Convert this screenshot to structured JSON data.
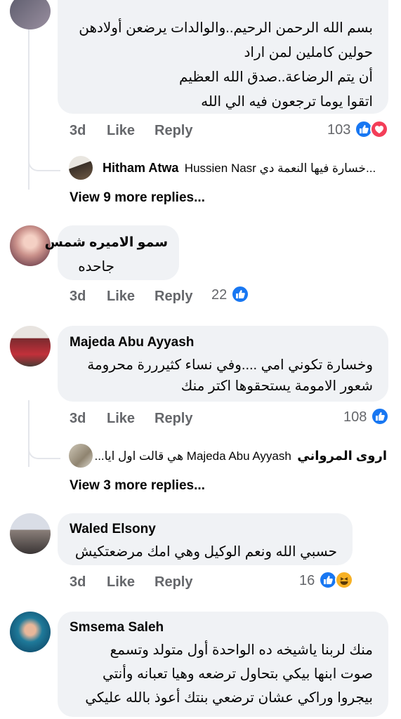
{
  "comments": [
    {
      "lines": [
        "بسم الله الرحمن الرحيم..والوالدات يرضعن أولادهن",
        "حولين كاملين لمن اراد",
        "أن يتم الرضاعة..صدق الله العظيم",
        "اتقوا يوما ترجعون فيه الي الله"
      ],
      "time": "3d",
      "like": "Like",
      "reply": "Reply",
      "reactions": "103",
      "reply_preview": {
        "author": "Hitham Atwa",
        "text": "Hussien Nasr خسارة فيها النعمة دي..."
      },
      "more_replies": "View 9 more replies..."
    },
    {
      "author": "سمو الاميره شمس",
      "lines": [
        "جاحده"
      ],
      "time": "3d",
      "like": "Like",
      "reply": "Reply",
      "reactions": "22"
    },
    {
      "author": "Majeda Abu Ayyash",
      "lines": [
        "وخسارة تكوني امي ....وفي نساء كثيرررة محرومة",
        "شعور الامومة يستحقوها اكتر منك"
      ],
      "time": "3d",
      "like": "Like",
      "reply": "Reply",
      "reactions": "108",
      "reply_preview": {
        "author": "اروى المرواني",
        "text": "Majeda Abu Ayyash هي قالت اول ايا..."
      },
      "more_replies": "View 3 more replies..."
    },
    {
      "author": "Waled Elsony",
      "lines": [
        "حسبي الله ونعم الوكيل وهي امك مرضعتكيش"
      ],
      "time": "3d",
      "like": "Like",
      "reply": "Reply",
      "reactions": "16"
    },
    {
      "author": "Smsema Saleh",
      "lines": [
        "منك لربنا ياشيخه ده الواحدة أول متولد وتسمع",
        "صوت ابنها بيكي بتحاول ترضعه وهيا تعبانه وأنتي",
        "بيجروا وراكي عشان ترضعي بنتك أعوذ بالله عليكي"
      ]
    }
  ],
  "colors": {
    "bubble": "#f0f2f5",
    "meta": "#65676b",
    "like_blue": "#1877f2",
    "love_red": "#f33e58",
    "haha_yellow": "#f7b125"
  },
  "icons": {
    "like": "like-reaction-icon",
    "love": "love-reaction-icon",
    "haha": "haha-reaction-icon"
  }
}
